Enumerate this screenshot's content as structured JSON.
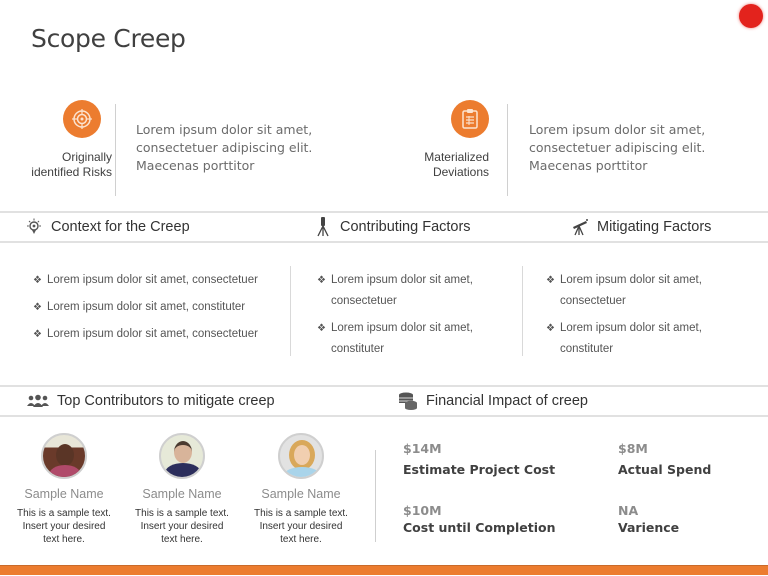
{
  "title": "Scope Creep",
  "colors": {
    "accent": "#ec7c2f",
    "record_dot": "#e3231d",
    "divider": "#e1e1e1"
  },
  "key_blocks": [
    {
      "icon": "target-icon",
      "label_lines": [
        "Originally",
        "identified Risks"
      ],
      "text_lines": [
        "Lorem ipsum dolor sit amet,",
        "consectetuer adipiscing elit.",
        "Maecenas porttitor"
      ]
    },
    {
      "icon": "clipboard-icon",
      "label_lines": [
        "Materialized",
        "Deviations"
      ],
      "text_lines": [
        "Lorem ipsum dolor sit amet,",
        "consectetuer adipiscing elit.",
        "Maecenas porttitor"
      ]
    }
  ],
  "sections": {
    "context": {
      "icon": "lightbulb-icon",
      "title": "Context for the Creep",
      "bullets": [
        "Lorem ipsum dolor sit amet, consectetuer",
        "Lorem ipsum dolor sit amet, constituter",
        "Lorem ipsum dolor sit amet, consectetuer"
      ]
    },
    "contributing": {
      "icon": "tripod-icon",
      "title": "Contributing Factors",
      "bullets": [
        [
          "Lorem ipsum dolor sit amet,",
          "consectetuer"
        ],
        [
          "Lorem ipsum dolor sit amet,",
          "constituter"
        ]
      ]
    },
    "mitigating": {
      "icon": "telescope-icon",
      "title": "Mitigating Factors",
      "bullets": [
        [
          "Lorem ipsum dolor sit amet,",
          "consectetuer"
        ],
        [
          "Lorem ipsum dolor sit amet,",
          "constituter"
        ]
      ]
    },
    "contributors": {
      "icon": "people-icon",
      "title": "Top Contributors to mitigate creep",
      "people": [
        {
          "name": "Sample Name",
          "desc_lines": [
            "This is a sample text.",
            "Insert your desired",
            "text here."
          ]
        },
        {
          "name": "Sample Name",
          "desc_lines": [
            "This is a sample text.",
            "Insert your desired",
            "text here."
          ]
        },
        {
          "name": "Sample Name",
          "desc_lines": [
            "This is a sample text.",
            "Insert your desired",
            "text here."
          ]
        }
      ]
    },
    "financial": {
      "icon": "coins-icon",
      "title": "Financial Impact of creep",
      "items": [
        {
          "value": "$14M",
          "label": "Estimate Project Cost"
        },
        {
          "value": "$8M",
          "label": "Actual Spend"
        },
        {
          "value": "$10M",
          "label": "Cost until Completion"
        },
        {
          "value": "NA",
          "label": "Varience"
        }
      ]
    }
  },
  "bullet_glyph": "❖"
}
